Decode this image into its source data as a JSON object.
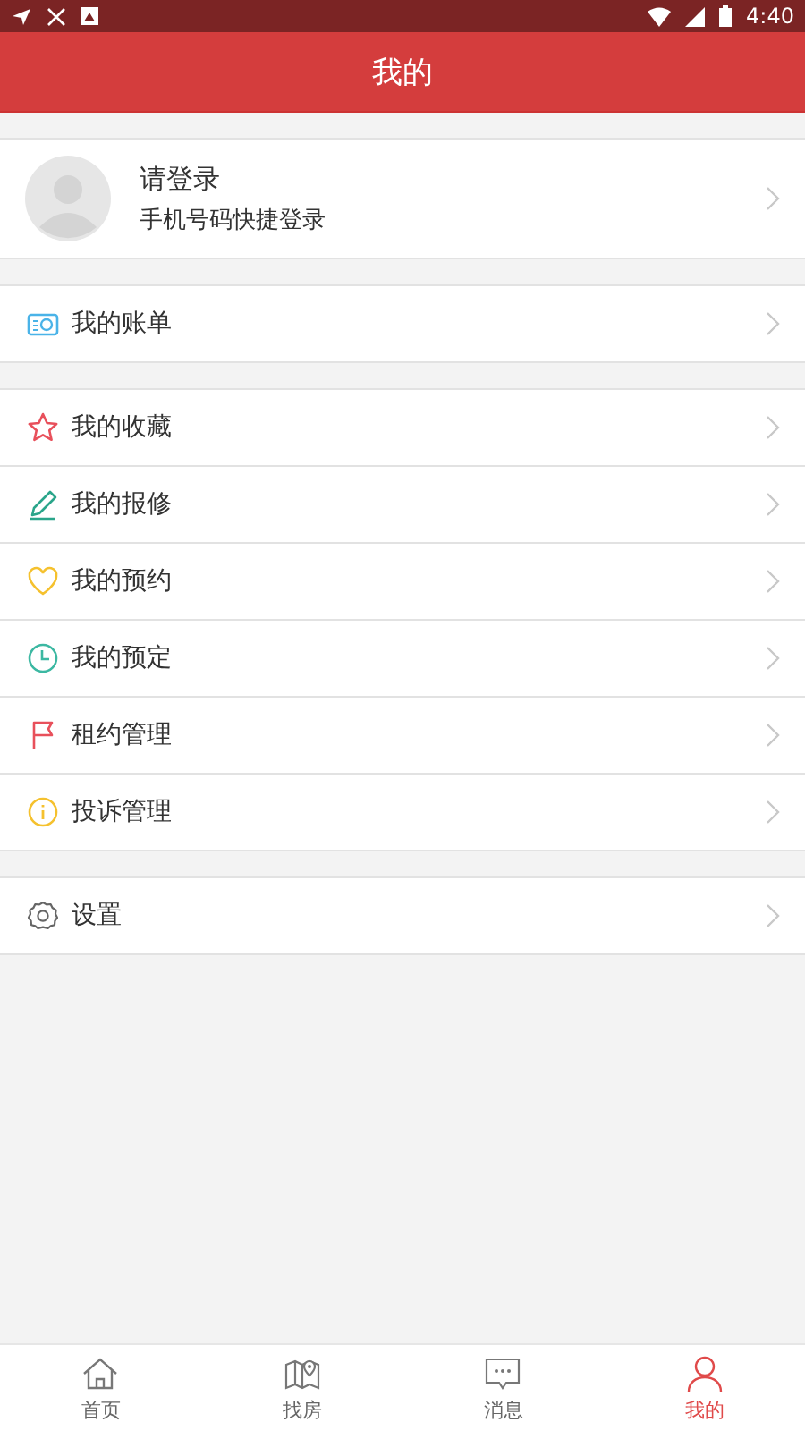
{
  "status_bar": {
    "time": "4:40"
  },
  "header": {
    "title": "我的"
  },
  "profile": {
    "name": "请登录",
    "subtitle": "手机号码快捷登录"
  },
  "menu_groups": [
    [
      {
        "kind": "bill",
        "label": "我的账单"
      }
    ],
    [
      {
        "kind": "star",
        "label": "我的收藏"
      },
      {
        "kind": "pencil",
        "label": "我的报修"
      },
      {
        "kind": "heart",
        "label": "我的预约"
      },
      {
        "kind": "clock",
        "label": "我的预定"
      },
      {
        "kind": "flag",
        "label": "租约管理"
      },
      {
        "kind": "info",
        "label": "投诉管理"
      }
    ],
    [
      {
        "kind": "gear",
        "label": "设置"
      }
    ]
  ],
  "tabs": [
    {
      "kind": "home",
      "label": "首页",
      "selected": false
    },
    {
      "kind": "map",
      "label": "找房",
      "selected": false
    },
    {
      "kind": "message",
      "label": "消息",
      "selected": false
    },
    {
      "kind": "person",
      "label": "我的",
      "selected": true
    }
  ]
}
